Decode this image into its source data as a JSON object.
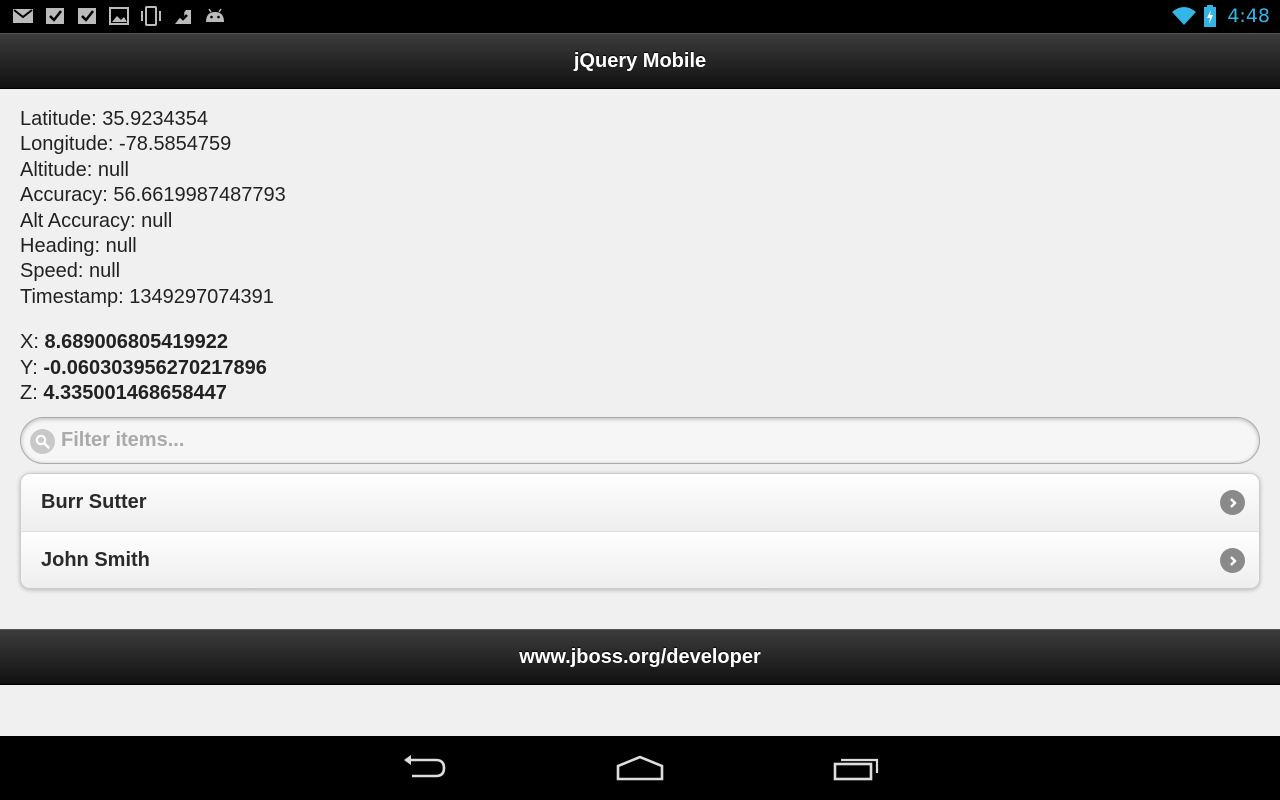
{
  "status_bar": {
    "time": "4:48",
    "notification_icons": [
      "gmail-icon",
      "task-done-icon",
      "task-done-icon",
      "gallery-icon",
      "vibrate-icon",
      "download-icon",
      "android-icon"
    ],
    "time_color": "#33b5e5"
  },
  "header": {
    "title": "jQuery Mobile"
  },
  "geolocation": {
    "lines": [
      "Latitude: 35.9234354",
      "Longitude: -78.5854759",
      "Altitude: null",
      "Accuracy: 56.6619987487793",
      "Alt Accuracy: null",
      "Heading: null",
      "Speed: null",
      "Timestamp: 1349297074391"
    ]
  },
  "accelerometer": {
    "x_label": "X:",
    "x_value": "8.689006805419922",
    "y_label": "Y:",
    "y_value": "-0.060303956270217896",
    "z_label": "Z:",
    "z_value": "4.335001468658447"
  },
  "filter": {
    "placeholder": "Filter items...",
    "value": ""
  },
  "list": {
    "items": [
      {
        "label": "Burr Sutter"
      },
      {
        "label": "John Smith"
      }
    ]
  },
  "footer": {
    "text": "www.jboss.org/developer"
  },
  "navigation": {
    "buttons": [
      "back-icon",
      "home-icon",
      "recent-apps-icon"
    ]
  }
}
